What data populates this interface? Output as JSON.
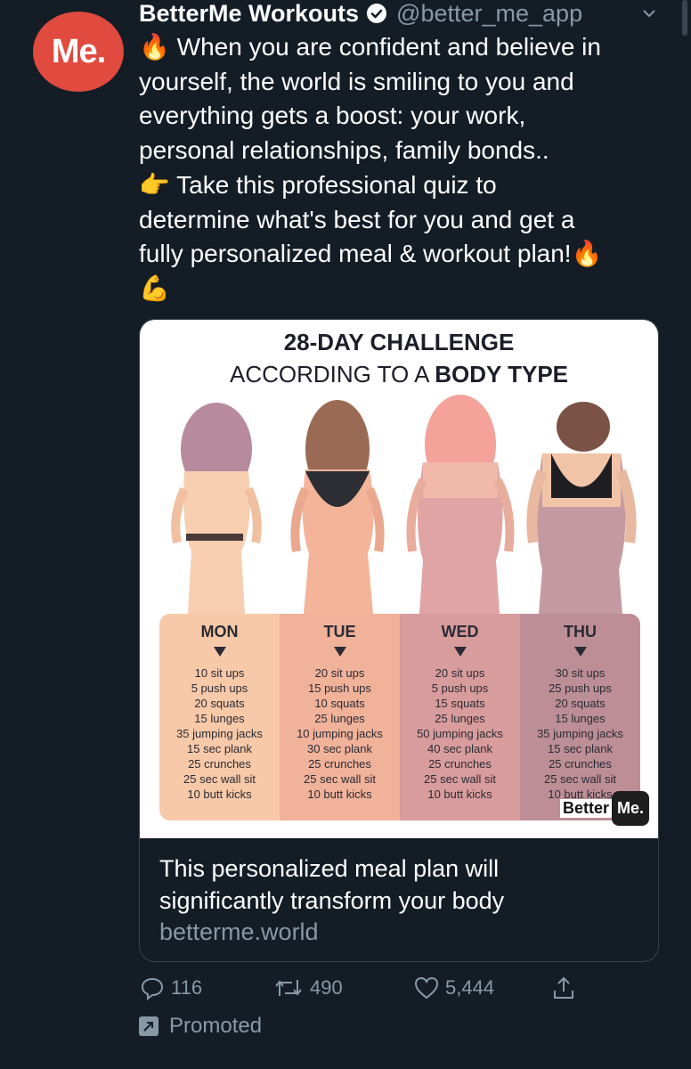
{
  "account": {
    "avatar_text": "Me.",
    "name": "BetterMe Workouts",
    "handle": "@better_me_app"
  },
  "tweet": {
    "line1_emoji": "🔥",
    "line1": "When you are confident and believe in",
    "line2": "yourself, the world is smiling to you and",
    "line3": "everything gets a boost: your work,",
    "line4": "personal relationships, family bonds..",
    "line5_emoji": "👉",
    "line5": "Take this professional quiz to",
    "line6": "determine what's best for you and get a",
    "line7": "fully personalized meal & workout plan!",
    "line7_emoji": "🔥",
    "line8_emoji": "💪"
  },
  "card": {
    "image_title": "28-DAY CHALLENGE",
    "image_subtitle_prefix": "ACCORDING TO A ",
    "image_subtitle_bold": "BODY TYPE",
    "days": [
      {
        "name": "MON",
        "items": [
          "10 sit ups",
          "5 push ups",
          "20 squats",
          "15 lunges",
          "35 jumping jacks",
          "15 sec plank",
          "25 crunches",
          "25 sec wall sit",
          "10 butt kicks"
        ],
        "color": "#f7c9a8"
      },
      {
        "name": "TUE",
        "items": [
          "20 sit ups",
          "15 push ups",
          "10 squats",
          "25 lunges",
          "10 jumping jacks",
          "30 sec plank",
          "25 crunches",
          "25 sec wall sit",
          "10 butt kicks"
        ],
        "color": "#f1b29a"
      },
      {
        "name": "WED",
        "items": [
          "20 sit ups",
          "5 push ups",
          "15 squats",
          "25 lunges",
          "50 jumping jacks",
          "40 sec plank",
          "25 crunches",
          "25 sec wall sit",
          "10 butt kicks"
        ],
        "color": "#d99c9c"
      },
      {
        "name": "THU",
        "items": [
          "30 sit ups",
          "25 push ups",
          "20 squats",
          "15 lunges",
          "35 jumping jacks",
          "15 sec plank",
          "25 crunches",
          "25 sec wall sit",
          "10 butt kicks"
        ],
        "color": "#bd8e96"
      }
    ],
    "logo_left": "Better",
    "logo_right": "Me.",
    "title_line1": "This personalized meal plan will",
    "title_line2": "significantly transform your body",
    "url": "betterme.world"
  },
  "actions": {
    "replies": "116",
    "retweets": "490",
    "likes": "5,444"
  },
  "promoted_label": "Promoted",
  "icons": [
    "verified-icon",
    "chevron-down-icon",
    "reply-icon",
    "retweet-icon",
    "like-icon",
    "share-icon",
    "promoted-icon"
  ]
}
